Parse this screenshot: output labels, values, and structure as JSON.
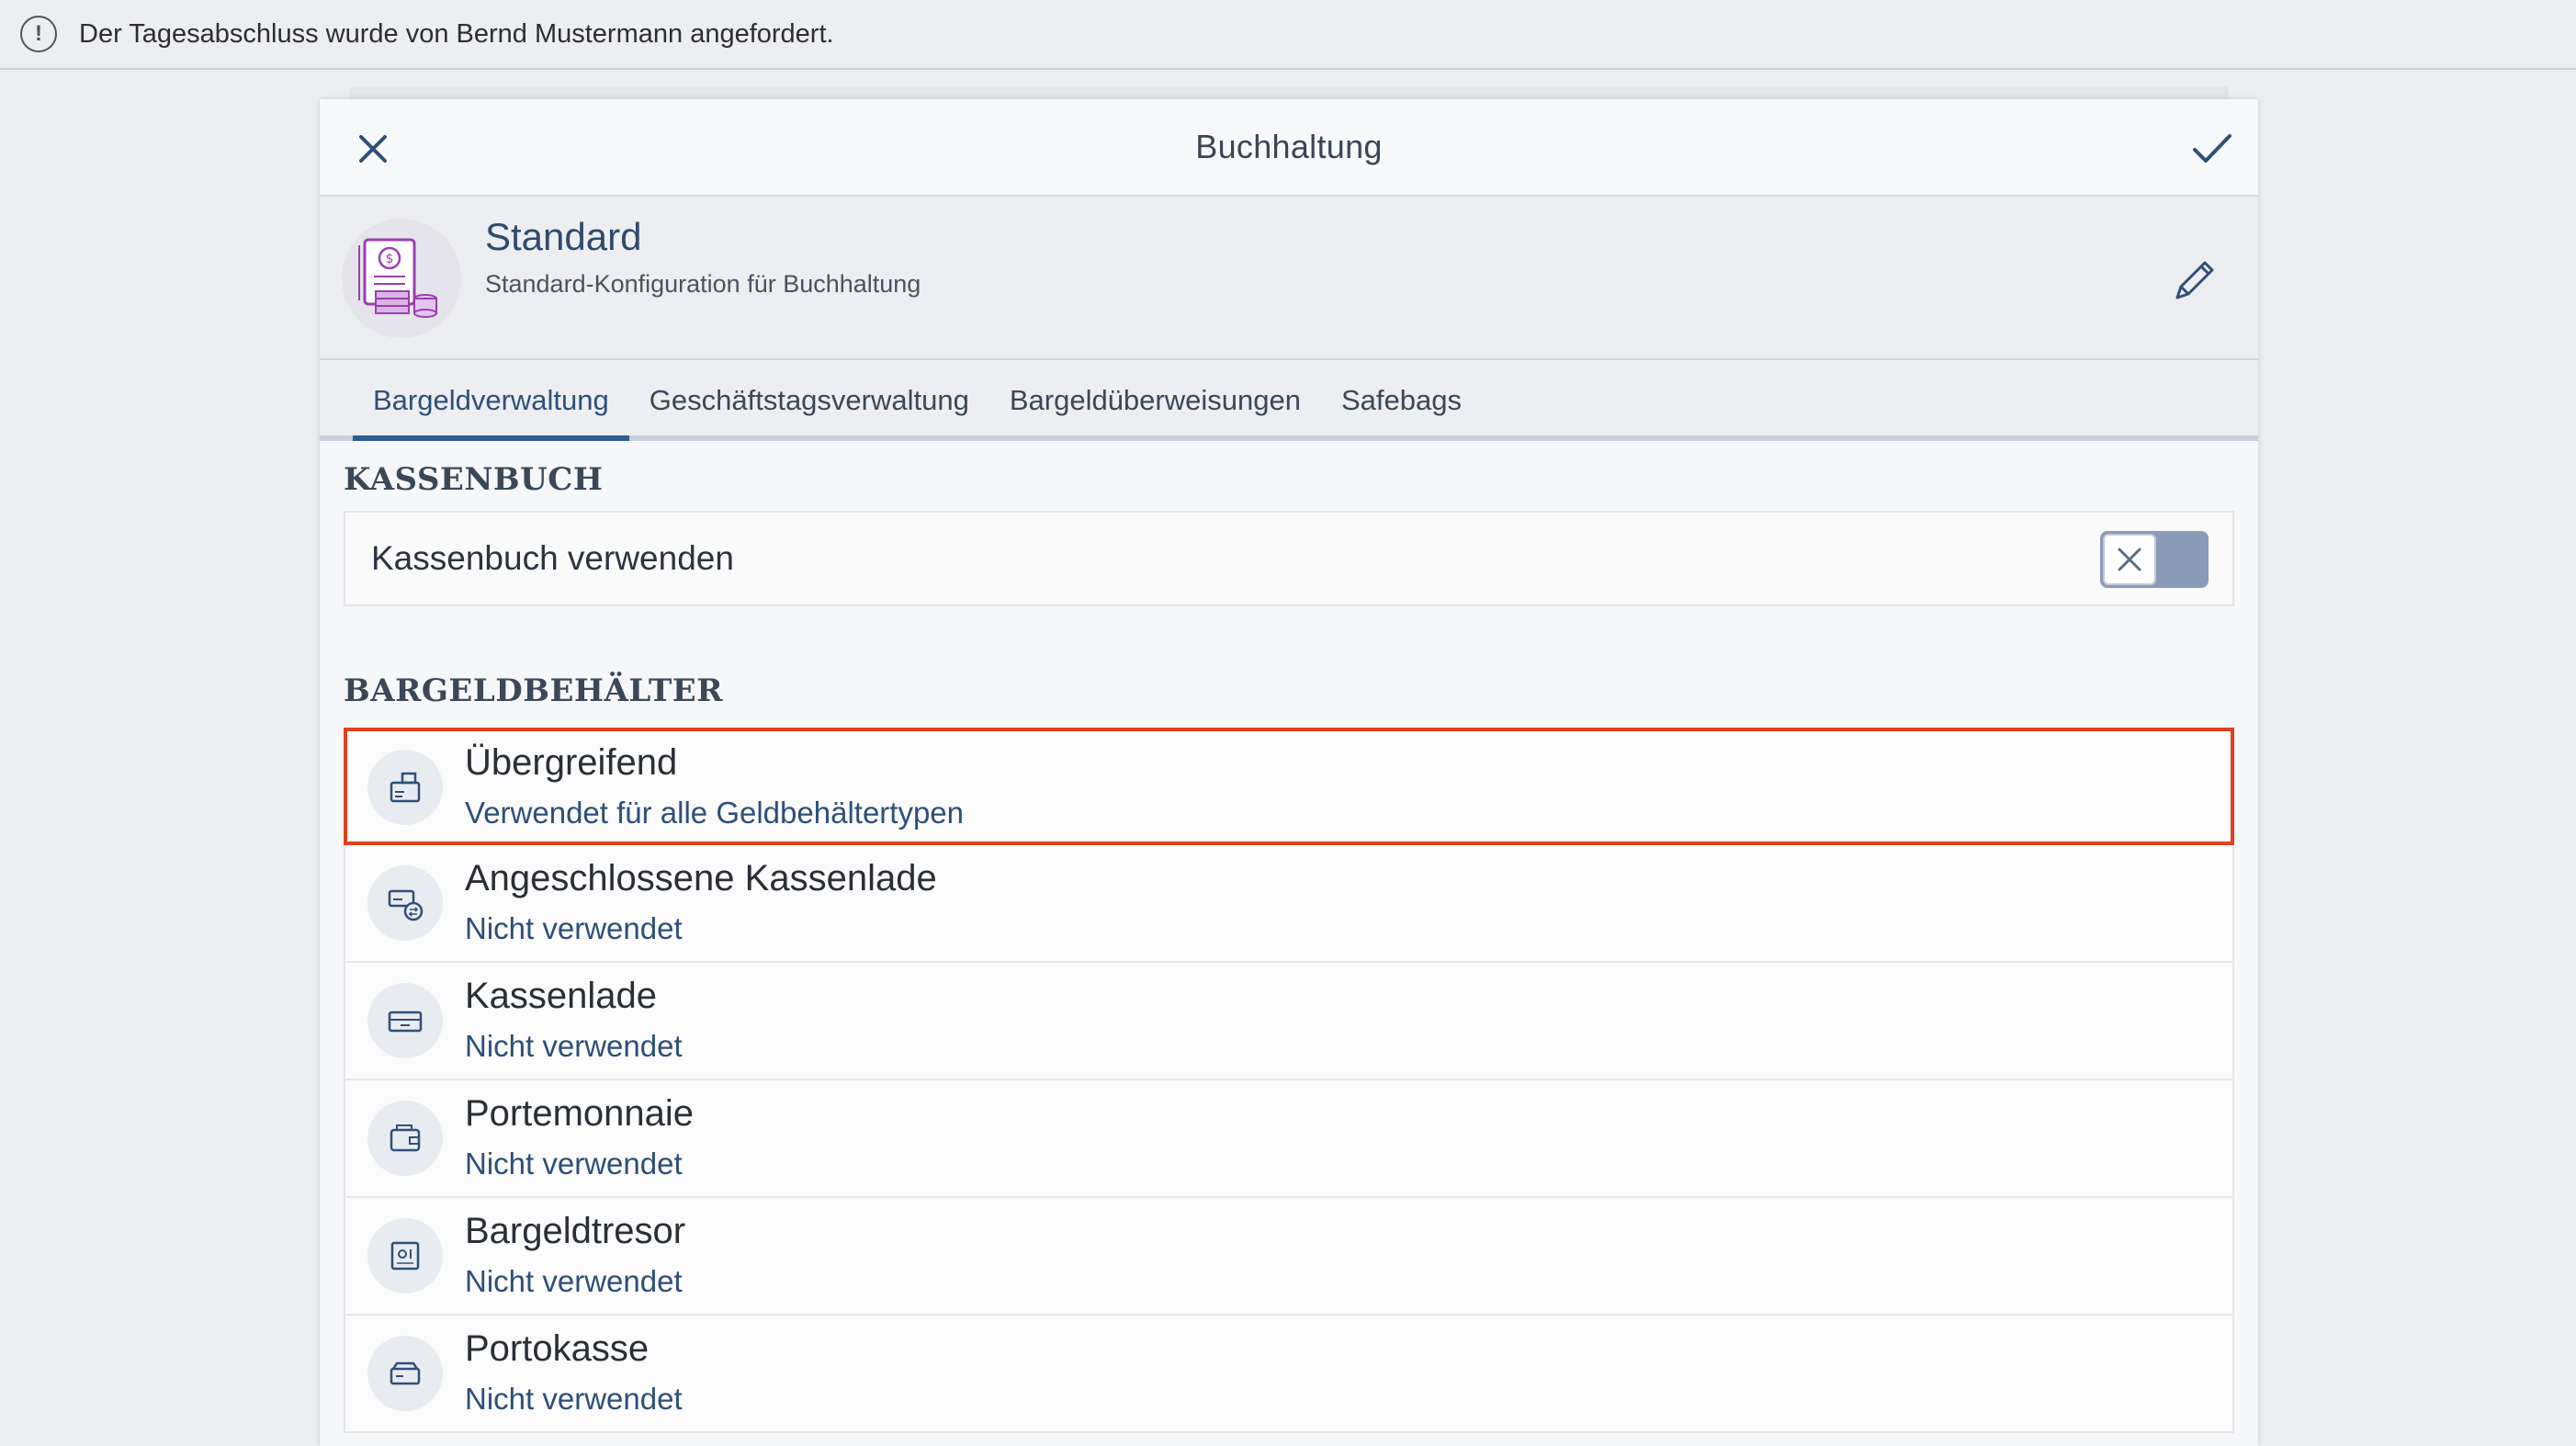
{
  "notification": {
    "message": "Der Tagesabschluss wurde von Bernd Mustermann angefordert.",
    "icon": "alert-circle-icon"
  },
  "dialog": {
    "title": "Buchhaltung",
    "close_icon": "close-icon",
    "confirm_icon": "checkmark-icon"
  },
  "configuration": {
    "name": "Standard",
    "description": "Standard-Konfiguration für Buchhaltung",
    "edit_icon": "pencil-icon"
  },
  "tabs": [
    {
      "label": "Bargeldverwaltung",
      "active": true
    },
    {
      "label": "Geschäftstagsverwaltung",
      "active": false
    },
    {
      "label": "Bargeldüberweisungen",
      "active": false
    },
    {
      "label": "Safebags",
      "active": false
    }
  ],
  "kassenbuch": {
    "section_title": "KASSENBUCH",
    "label": "Kassenbuch verwenden",
    "enabled": false
  },
  "containers": {
    "section_title": "BARGELDBEHÄLTER",
    "items": [
      {
        "name": "Übergreifend",
        "status": "Verwendet für alle Geldbehältertypen",
        "icon": "cash-register-icon",
        "selected": true
      },
      {
        "name": "Angeschlossene Kassenlade",
        "status": "Nicht verwendet",
        "icon": "connected-drawer-icon",
        "selected": false
      },
      {
        "name": "Kassenlade",
        "status": "Nicht verwendet",
        "icon": "cash-drawer-icon",
        "selected": false
      },
      {
        "name": "Portemonnaie",
        "status": "Nicht verwendet",
        "icon": "wallet-icon",
        "selected": false
      },
      {
        "name": "Bargeldtresor",
        "status": "Nicht verwendet",
        "icon": "safe-icon",
        "selected": false
      },
      {
        "name": "Portokasse",
        "status": "Nicht verwendet",
        "icon": "petty-cash-icon",
        "selected": false
      }
    ]
  },
  "colors": {
    "accent": "#2f5d90",
    "selection_border": "#e3401f",
    "toggle_off": "#8a9bb8"
  }
}
